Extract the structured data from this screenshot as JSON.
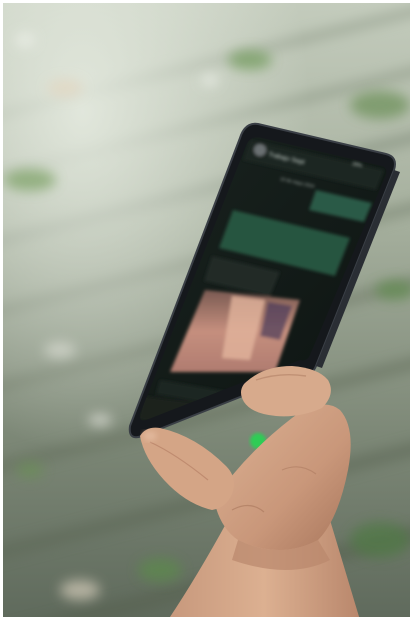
{
  "scene": {
    "palette": {
      "ground_light": "#a9b4a1",
      "ground_dark": "#5f6a5c",
      "moss": "#6f9a5a",
      "phone_body": "#1b1e22",
      "screen_dark": "#0f1714",
      "bubble_green": "#1f4a3a",
      "skin": "#d2a585",
      "skin_shadow": "#a8765c",
      "call_green": "#2ecc55"
    },
    "phone": {
      "contact_name": "Trabajo Sept",
      "status_battery": "39%",
      "date_separator": "10 de mayo 2024"
    }
  }
}
